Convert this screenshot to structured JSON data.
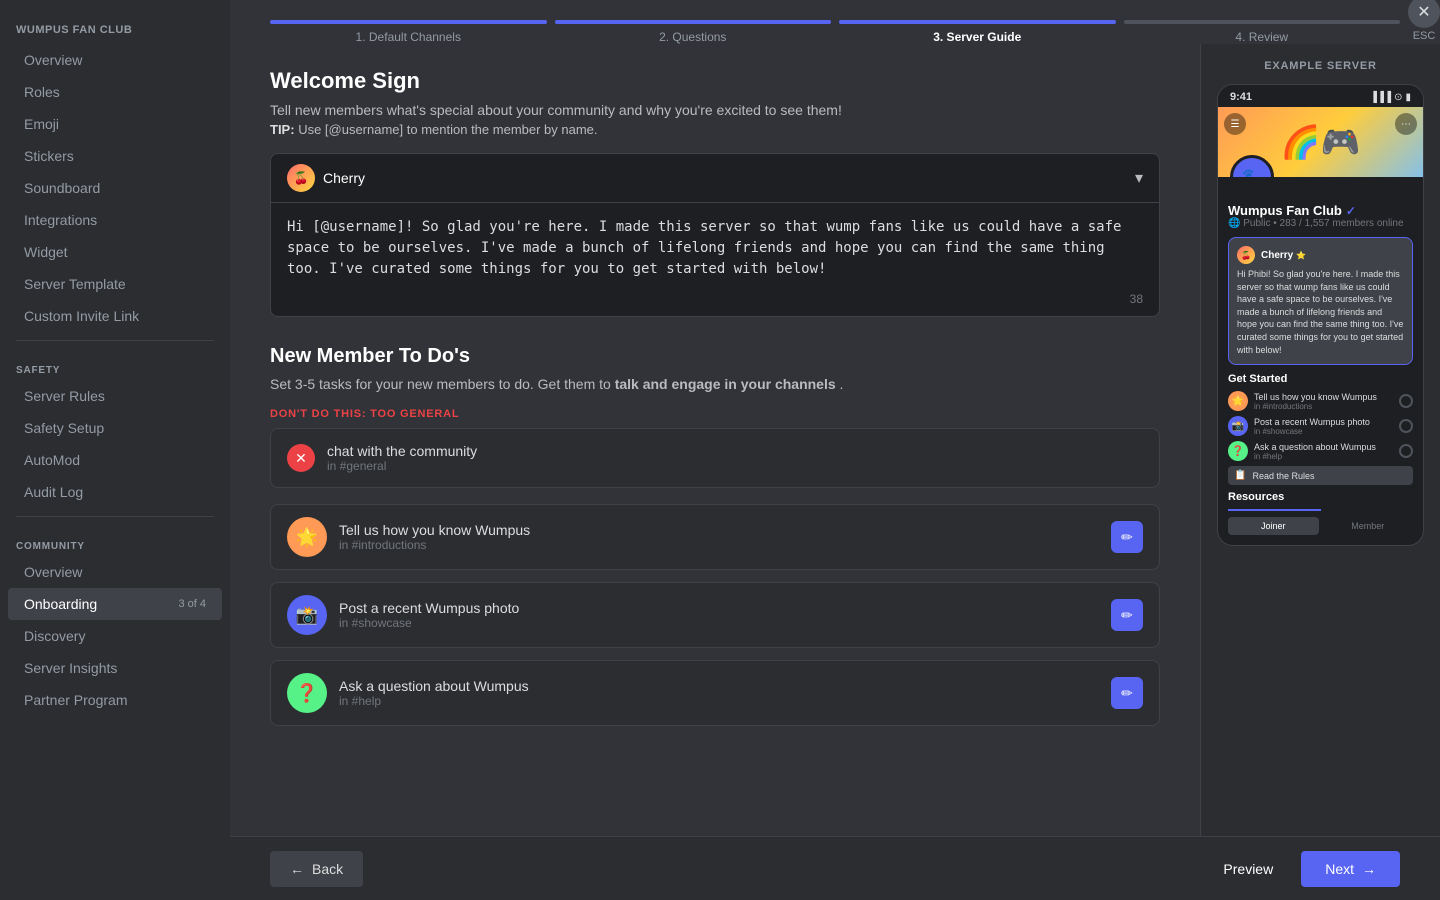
{
  "sidebar": {
    "server_name": "WUMPUS FAN CLUB",
    "items_general": [
      {
        "label": "Overview",
        "active": false
      },
      {
        "label": "Roles",
        "active": false
      },
      {
        "label": "Emoji",
        "active": false
      },
      {
        "label": "Stickers",
        "active": false
      },
      {
        "label": "Soundboard",
        "active": false
      },
      {
        "label": "Integrations",
        "active": false
      },
      {
        "label": "Widget",
        "active": false
      },
      {
        "label": "Server Template",
        "active": false
      },
      {
        "label": "Custom Invite Link",
        "active": false
      }
    ],
    "safety_label": "SAFETY",
    "items_safety": [
      {
        "label": "Server Rules",
        "active": false
      },
      {
        "label": "Safety Setup",
        "active": false
      },
      {
        "label": "AutoMod",
        "active": false
      },
      {
        "label": "Audit Log",
        "active": false
      }
    ],
    "community_label": "COMMUNITY",
    "items_community": [
      {
        "label": "Overview",
        "active": false
      },
      {
        "label": "Onboarding",
        "active": true,
        "badge": "3 of 4"
      },
      {
        "label": "Discovery",
        "active": false
      },
      {
        "label": "Server Insights",
        "active": false
      },
      {
        "label": "Partner Program",
        "active": false
      }
    ]
  },
  "steps": [
    {
      "label": "1. Default Channels",
      "state": "done"
    },
    {
      "label": "2. Questions",
      "state": "done"
    },
    {
      "label": "3. Server Guide",
      "state": "active"
    },
    {
      "label": "4. Review",
      "state": "inactive"
    }
  ],
  "esc": {
    "label": "ESC"
  },
  "welcome_sign": {
    "title": "Welcome Sign",
    "description": "Tell new members what's special about your community and why you're excited to see them!",
    "tip": "TIP:",
    "tip_text": " Use [@username] to mention the member by name.",
    "username": "Cherry",
    "message": "Hi [@username]! So glad you're here. I made this server so that wump fans like us could have a safe space to be ourselves. I've made a bunch of lifelong friends and hope you can find the same thing too. I've curated some things for you to get started with below!",
    "char_count": "38"
  },
  "new_member_todos": {
    "title": "New Member To Do's",
    "description": "Set 3-5 tasks for your new members to do. Get them to",
    "description_bold": " talk and engage in your channels",
    "description_end": ".",
    "dont_label": "DON'T DO THIS: TOO GENERAL",
    "bad_example": {
      "title": "chat with the community",
      "channel": "in #general"
    },
    "tasks": [
      {
        "title": "Tell us how you know Wumpus",
        "channel": "in #introductions",
        "avatar_emoji": "🌟",
        "avatar_bg": "#ff9a56"
      },
      {
        "title": "Post a recent Wumpus photo",
        "channel": "in #showcase",
        "avatar_emoji": "📸",
        "avatar_bg": "#5865f2"
      },
      {
        "title": "Ask a question about Wumpus",
        "channel": "in #help",
        "avatar_emoji": "❓",
        "avatar_bg": "#57f287"
      }
    ]
  },
  "example_server": {
    "label": "EXAMPLE SERVER",
    "time": "9:41",
    "server_name": "Wumpus Fan Club",
    "server_meta_public": "Public",
    "server_meta_members": "283 / 1,557 members online",
    "cherry_name": "Cherry",
    "welcome_text": "Hi Phibi! So glad you're here. I made this server so that wump fans like us could have a safe space to be ourselves. I've made a bunch of lifelong friends and hope you can find the same thing too. I've curated some things for you to get started with below!",
    "get_started_label": "Get Started",
    "phone_tasks": [
      {
        "name": "Tell us how you know Wumpus",
        "channel": "in #introductions"
      },
      {
        "name": "Post a recent Wumpus photo",
        "channel": "in #showcase"
      },
      {
        "name": "Ask a question about Wumpus",
        "channel": "in #help"
      }
    ],
    "rules_label": "Read the Rules",
    "resources_label": "Resources",
    "tab_joiner": "Joiner",
    "tab_member": "Member"
  },
  "footer": {
    "back_label": "Back",
    "preview_label": "Preview",
    "next_label": "Next"
  }
}
